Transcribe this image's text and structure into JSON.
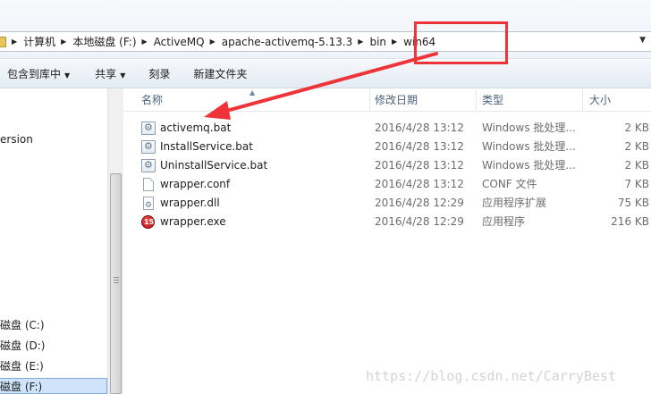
{
  "address_bar": {
    "breadcrumbs": [
      "计算机",
      "本地磁盘 (F:)",
      "ActiveMQ",
      "apache-activemq-5.13.3",
      "bin",
      "win64"
    ]
  },
  "toolbar": {
    "buttons": [
      {
        "label": "包含到库中",
        "has_dropdown": true
      },
      {
        "label": "共享",
        "has_dropdown": true
      },
      {
        "label": "刻录",
        "has_dropdown": false
      },
      {
        "label": "新建文件夹",
        "has_dropdown": false
      }
    ]
  },
  "nav_pane": {
    "items": [
      "ersion",
      "磁盘 (C:)",
      "磁盘 (D:)",
      "磁盘 (E:)",
      "磁盘 (F:)"
    ],
    "selected_index": 4
  },
  "file_list": {
    "columns": {
      "name": "名称",
      "date": "修改日期",
      "type": "类型",
      "size": "大小"
    },
    "rows": [
      {
        "name": "activemq.bat",
        "date": "2016/4/28 13:12",
        "type": "Windows 批处理...",
        "size": "2 KB",
        "icon": "batch-file-icon"
      },
      {
        "name": "InstallService.bat",
        "date": "2016/4/28 13:12",
        "type": "Windows 批处理...",
        "size": "2 KB",
        "icon": "batch-file-icon"
      },
      {
        "name": "UninstallService.bat",
        "date": "2016/4/28 13:12",
        "type": "Windows 批处理...",
        "size": "2 KB",
        "icon": "batch-file-icon"
      },
      {
        "name": "wrapper.conf",
        "date": "2016/4/28 13:12",
        "type": "CONF 文件",
        "size": "7 KB",
        "icon": "conf-file-icon"
      },
      {
        "name": "wrapper.dll",
        "date": "2016/4/28 12:29",
        "type": "应用程序扩展",
        "size": "75 KB",
        "icon": "dll-file-icon"
      },
      {
        "name": "wrapper.exe",
        "date": "2016/4/28 12:29",
        "type": "应用程序",
        "size": "216 KB",
        "icon": "exe-file-icon"
      }
    ]
  },
  "annotation": {
    "color": "#ee3339"
  },
  "watermark": "https://blog.csdn.net/CarryBest"
}
